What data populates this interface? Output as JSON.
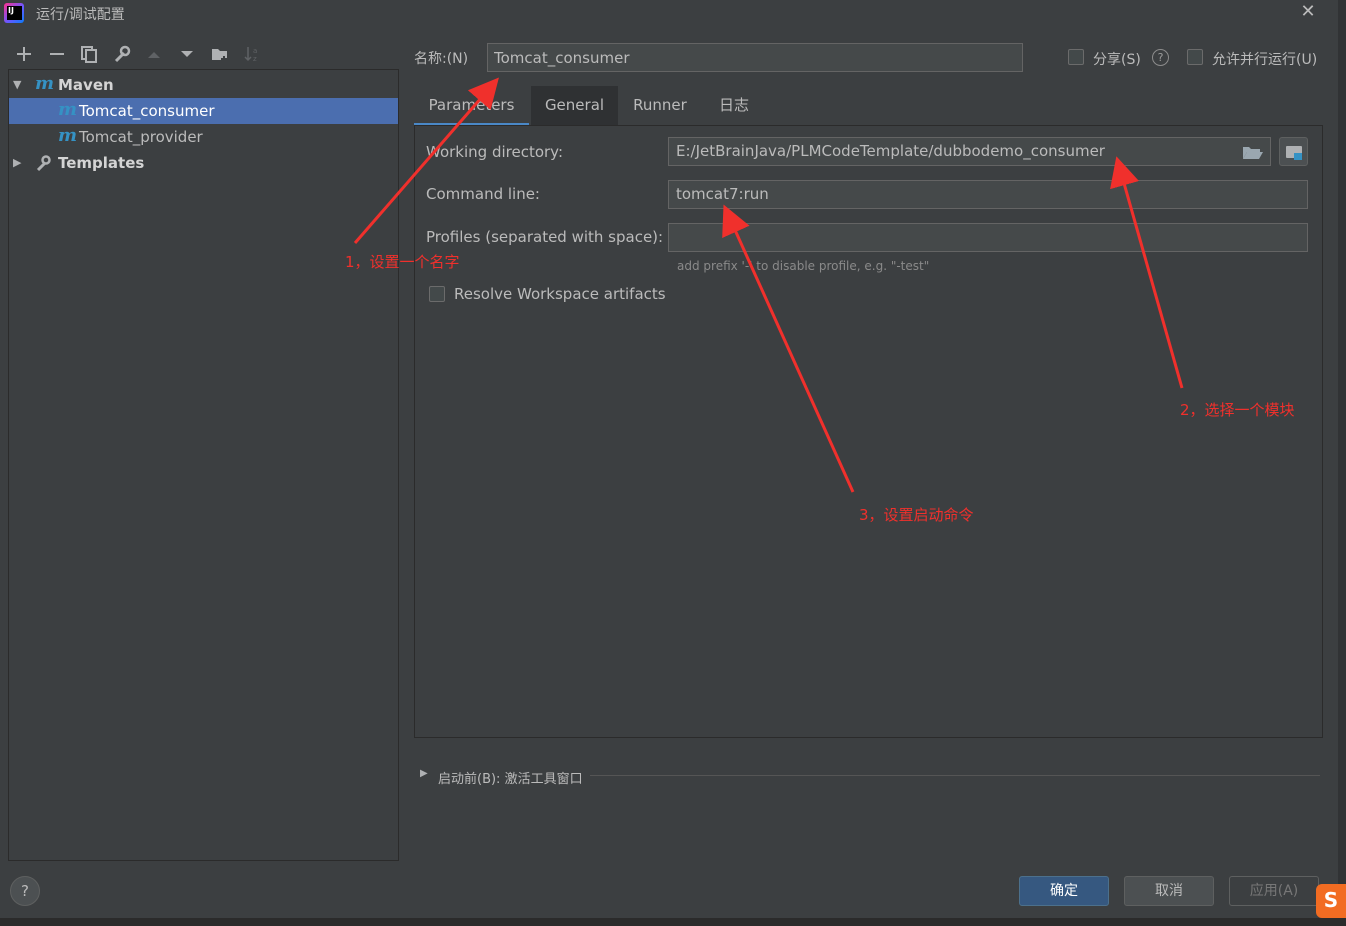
{
  "window": {
    "title": "运行/调试配置",
    "close_glyph": "✕"
  },
  "toolbar": [
    "plus-icon",
    "minus-icon",
    "copy-icon",
    "wrench-icon",
    "move-up-icon",
    "move-down-icon",
    "folder-add-icon",
    "sort-icon"
  ],
  "tree": {
    "maven": {
      "label": "Maven",
      "icon_glyph": "m",
      "arrow": "▼"
    },
    "items": [
      {
        "label": "Tomcat_consumer",
        "selected": true
      },
      {
        "label": "Tomcat_provider",
        "selected": false
      }
    ],
    "templates": {
      "label": "Templates",
      "arrow": "▶"
    }
  },
  "name_row": {
    "label": "名称:(N)",
    "value": "Tomcat_consumer",
    "share_label": "分享(S)",
    "help_glyph": "?",
    "parallel_label": "允许并行运行(U)"
  },
  "tabs": [
    "Parameters",
    "General",
    "Runner",
    "日志"
  ],
  "parameters": {
    "working_directory_label": "Working directory:",
    "working_directory_value": "E:/JetBrainJava/PLMCodeTemplate/dubbodemo_consumer",
    "command_line_label": "Command line:",
    "command_line_value": "tomcat7:run",
    "profiles_label": "Profiles (separated with space):",
    "profiles_value": "",
    "profiles_hint": "add prefix '-' to disable profile, e.g. \"-test\"",
    "resolve_label": "Resolve Workspace artifacts"
  },
  "before_launch": {
    "arrow": "▶",
    "label": "启动前(B): 激活工具窗口"
  },
  "buttons": {
    "ok": "确定",
    "cancel": "取消",
    "apply": "应用(A)",
    "help": "?"
  },
  "annotations": {
    "a1": "1，设置一个名字",
    "a2": "2，选择一个模块",
    "a3": "3，设置启动命令",
    "color": "#f0302c"
  },
  "sogou_glyph": "S"
}
